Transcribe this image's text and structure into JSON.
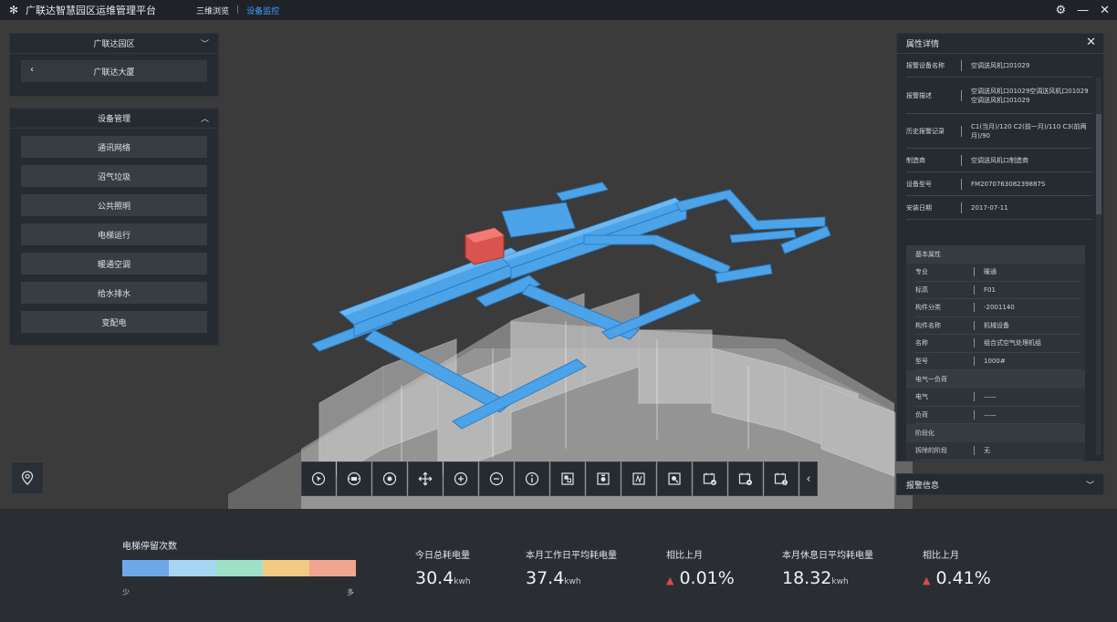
{
  "app": {
    "title": "广联达智慧园区运维管理平台",
    "nav": [
      {
        "label": "三维浏览",
        "active": false
      },
      {
        "label": "设备监控",
        "active": true
      }
    ]
  },
  "left": {
    "park_title": "广联达园区",
    "building": "广联达大厦",
    "device_mgmt_title": "设备管理",
    "menu": [
      "通讯网络",
      "沼气垃圾",
      "公共照明",
      "电梯运行",
      "暖通空调",
      "给水排水",
      "变配电"
    ]
  },
  "right": {
    "title": "属性详情",
    "properties": [
      {
        "key": "报警设备名称",
        "value": "空调送风机口01029"
      },
      {
        "key": "报警描述",
        "value": "空调送风机口01029空调送风机口01029空调送风机口01029"
      },
      {
        "key": "历史报警记录",
        "value": "C1(当月)/120 C2(前一月)/110 C3(前两月)/90"
      },
      {
        "key": "制造商",
        "value": "空调送风机口制造商"
      },
      {
        "key": "设备型号",
        "value": "FM207076308239887S"
      },
      {
        "key": "安装日期",
        "value": "2017-07-11"
      }
    ],
    "basic_sections": [
      {
        "title": "基本属性",
        "rows": [
          {
            "key": "专业",
            "value": "暖通"
          },
          {
            "key": "标高",
            "value": "F01"
          },
          {
            "key": "构件分类",
            "value": "-2001140"
          },
          {
            "key": "构件名称",
            "value": "机械设备"
          },
          {
            "key": "名称",
            "value": "组合式空气处理机组"
          },
          {
            "key": "型号",
            "value": "1000#"
          }
        ]
      },
      {
        "title": "电气一负荷",
        "rows": [
          {
            "key": "电气",
            "value": "——"
          },
          {
            "key": "负荷",
            "value": "——"
          }
        ]
      },
      {
        "title": "阶段化",
        "rows": [
          {
            "key": "拆除的阶段",
            "value": "无"
          }
        ]
      }
    ],
    "alarm_title": "报警信息"
  },
  "toolbar": {
    "icons": [
      "select-icon",
      "rotate-icon",
      "orbit-icon",
      "pan-icon",
      "zoom-in-icon",
      "zoom-out-icon",
      "info-icon",
      "section-box-icon",
      "screenshot-icon",
      "measure-icon",
      "zoom-window-icon",
      "schedule-check-icon",
      "schedule-settings-icon",
      "schedule-alert-icon"
    ]
  },
  "legend": {
    "title": "电梯停留次数",
    "min": "少",
    "max": "多",
    "colors": [
      "#6fa8e8",
      "#a6d6f2",
      "#9fe0c8",
      "#f4c983",
      "#f0a58e"
    ]
  },
  "stats": [
    {
      "label": "今日总耗电量",
      "value": "30.4",
      "unit": "kwh"
    },
    {
      "label": "本月工作日平均耗电量",
      "value": "37.4",
      "unit": "kwh"
    },
    {
      "label": "相比上月",
      "value": "0.01%",
      "trend": "up"
    },
    {
      "label": "本月休息日平均耗电量",
      "value": "18.32",
      "unit": "kwh"
    },
    {
      "label": "相比上月",
      "value": "0.41%",
      "trend": "up"
    }
  ],
  "colors": {
    "duct": "#4da3e8",
    "alarm_box": "#d9534f",
    "accent": "#3f9bff",
    "trend_up": "#e0474c"
  }
}
